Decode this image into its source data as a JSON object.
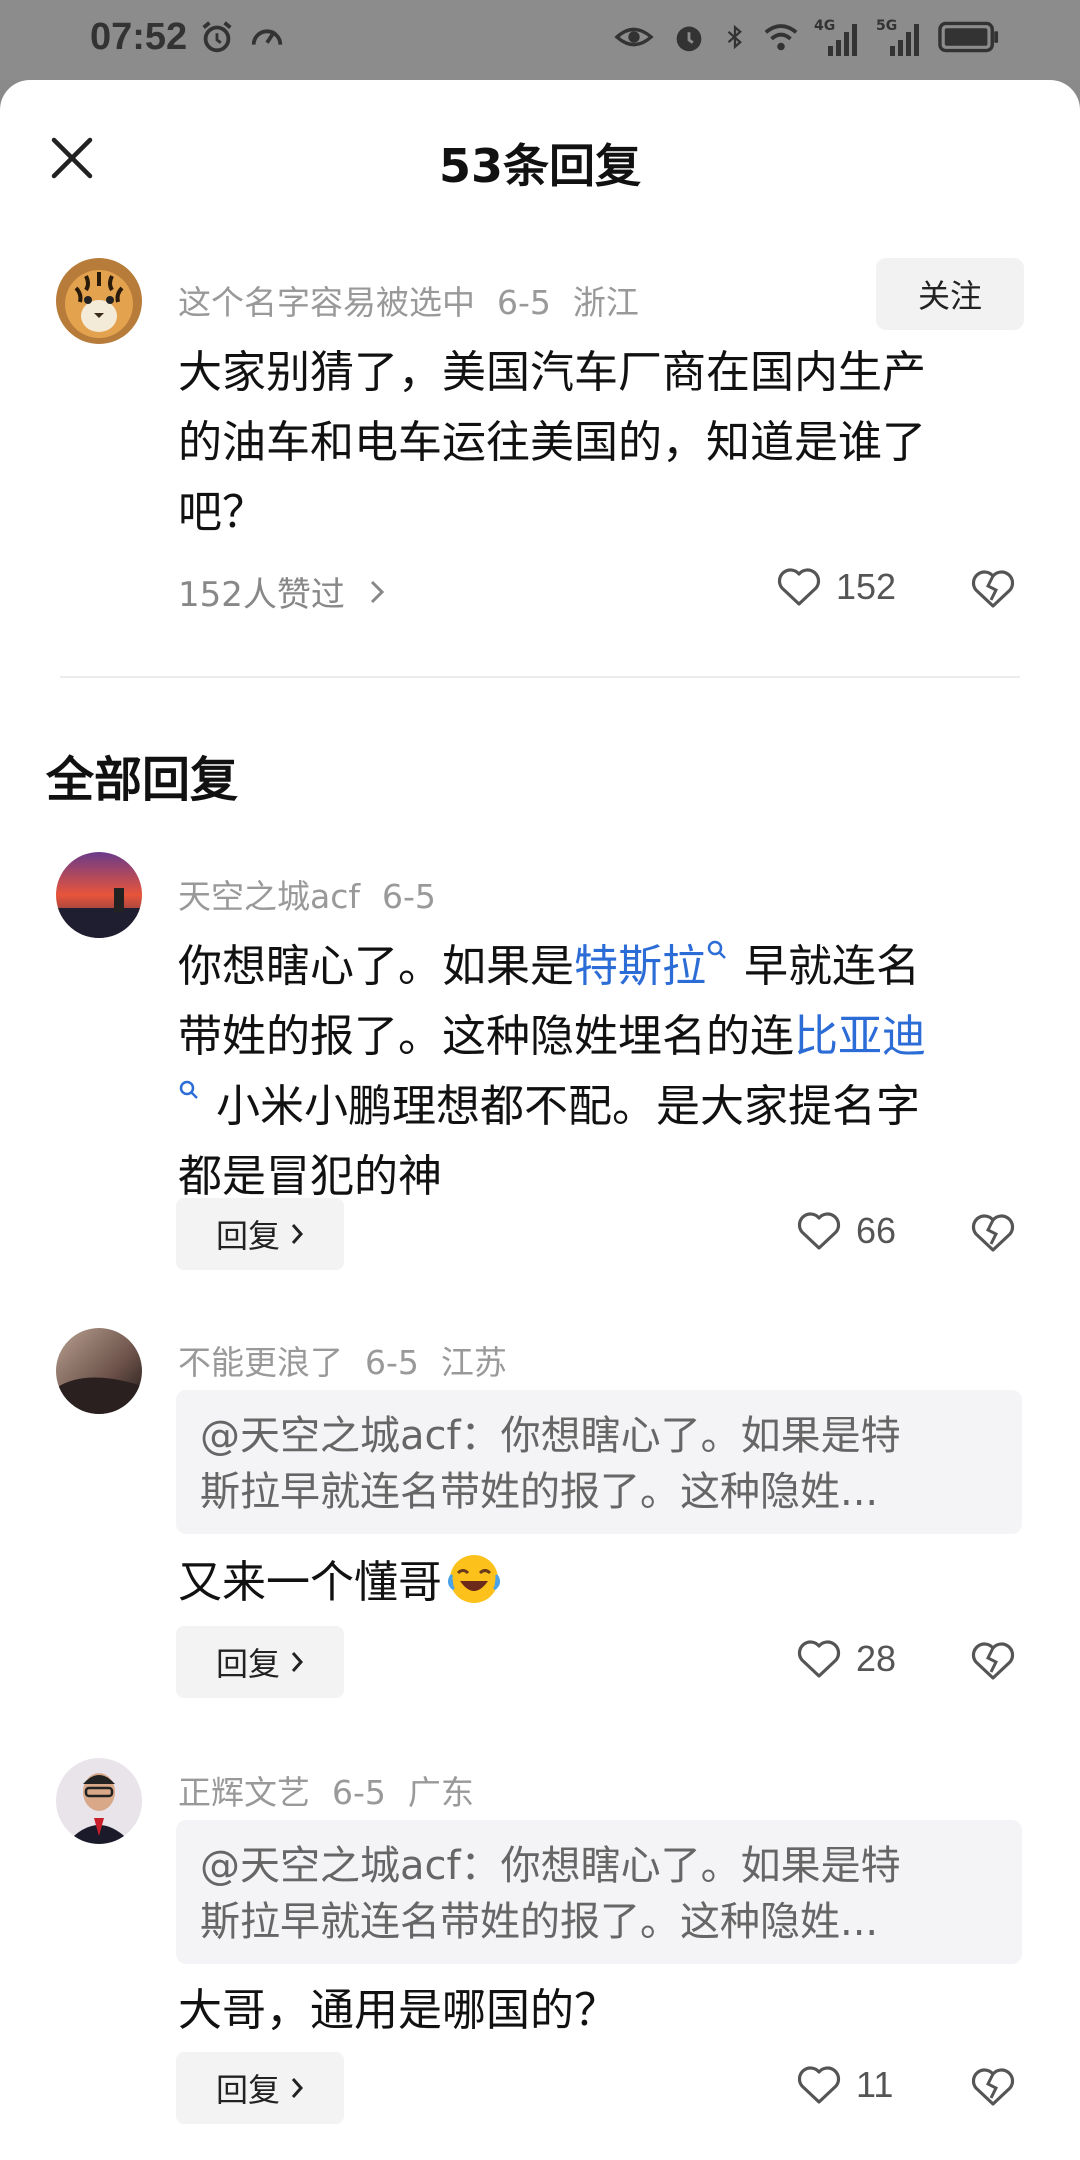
{
  "status_bar": {
    "time": "07:52",
    "left_icons": [
      "alarm-icon",
      "speedometer-icon"
    ],
    "right_icons": [
      "eye-icon",
      "alarm-icon",
      "bluetooth-icon",
      "wifi-icon",
      "signal-4g-icon",
      "signal-5g-icon",
      "battery-icon"
    ],
    "signal_4g_label": "4G",
    "signal_5g_label": "5G"
  },
  "header": {
    "title": "53条回复",
    "close_icon": "close-icon"
  },
  "main_comment": {
    "author": "这个名字容易被选中",
    "date": "6-5",
    "location": "浙江",
    "follow_label": "关注",
    "text_lines": [
      "大家别猜了，美国汽车厂商在国内生产",
      "的油车和电车运往美国的，知道是谁了",
      "吧？"
    ],
    "likers_label": "152人赞过",
    "like_count": "152",
    "avatar_icon": "tiger-avatar"
  },
  "section": {
    "title": "全部回复"
  },
  "replies": [
    {
      "author": "天空之城acf",
      "date": "6-5",
      "location": "",
      "text_line1_a": "你想瞎心了。如果是",
      "text_line1_link": "特斯拉",
      "text_line1_b": " 早就连名",
      "text_line2_a": "带姓的报了。这种隐姓埋名的连",
      "text_line2_link": "比亚迪",
      "text_line3": " 小米小鹏理想都不配。是大家提名字",
      "text_line4": "都是冒犯的神",
      "reply_label": "回复",
      "like_count": "66"
    },
    {
      "author": "不能更浪了",
      "date": "6-5",
      "location": "江苏",
      "quote_lines": [
        "@天空之城acf：你想瞎心了。如果是特",
        "斯拉早就连名带姓的报了。这种隐姓..."
      ],
      "text": "又来一个懂哥",
      "emoji": "laughing-crying-emoji",
      "reply_label": "回复",
      "like_count": "28"
    },
    {
      "author": "正辉文艺",
      "date": "6-5",
      "location": "广东",
      "quote_lines": [
        "@天空之城acf：你想瞎心了。如果是特",
        "斯拉早就连名带姓的报了。这种隐姓..."
      ],
      "text": "大哥，通用是哪国的？",
      "reply_label": "回复",
      "like_count": "11"
    }
  ],
  "colors": {
    "link": "#2c6cd6",
    "meta_gray": "#999999",
    "button_bg": "#f3f3f3",
    "quote_bg": "#f4f4f6"
  }
}
